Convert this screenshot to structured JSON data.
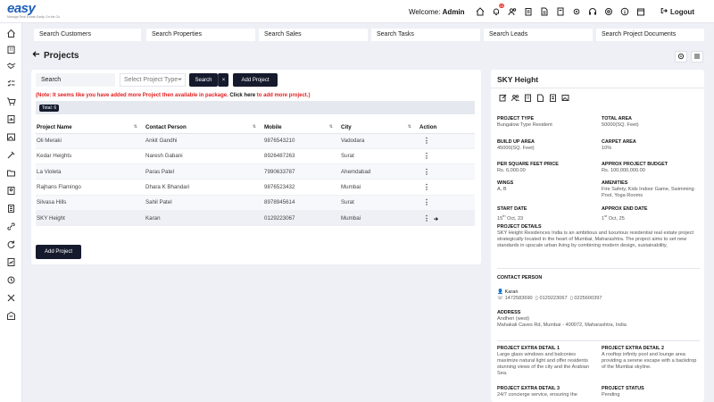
{
  "header": {
    "logo_text": "easy",
    "logo_tagline": "Manage Real Estate Easily On the Go",
    "welcome_label": "Welcome:",
    "welcome_user": "Admin",
    "notification_count": "23",
    "logout_label": "Logout"
  },
  "searches": [
    "Search Customers",
    "Search Properties",
    "Search Sales",
    "Search Tasks",
    "Search Leads",
    "Search Project Documents"
  ],
  "page": {
    "title": "Projects"
  },
  "filters": {
    "search_placeholder": "Search",
    "select_placeholder": "Select Project Type",
    "search_button": "Search",
    "clear_button": "×",
    "add_button": "Add Project"
  },
  "note": {
    "red": "(Note: It seems like you have added more Project then available in package.",
    "black": "Click here",
    "red_tail": "to add more project.)"
  },
  "total_label": "Total: 6",
  "table": {
    "headers": [
      "Project Name",
      "Contact Person",
      "Mobile",
      "City",
      "Action"
    ],
    "rows": [
      {
        "name": "Oli Meraki",
        "contact": "Ankit Gandhi",
        "mobile": "9876543210",
        "city": "Vadodara"
      },
      {
        "name": "Kedar Heights",
        "contact": "Naresh Gabani",
        "mobile": "8926487263",
        "city": "Surat"
      },
      {
        "name": "La Violeta",
        "contact": "Paras Patel",
        "mobile": "7990633787",
        "city": "Ahemdabad"
      },
      {
        "name": "Rajhans Flamingo",
        "contact": "Dhara K Bhandari",
        "mobile": "9876523432",
        "city": "Mumbai"
      },
      {
        "name": "Silvasa Hills",
        "contact": "Sahil Patel",
        "mobile": "8978945614",
        "city": "Surat"
      },
      {
        "name": "SKY Height",
        "contact": "Karan",
        "mobile": "0129223067",
        "city": "Mumbai"
      }
    ]
  },
  "add_project_bottom": "Add Project",
  "detail": {
    "title": "SKY Height",
    "project_type_label": "PROJECT TYPE",
    "project_type": "Bungalow Type Resident",
    "total_area_label": "TOTAL AREA",
    "total_area": "50000(SQ. Feet)",
    "build_up_label": "BUILD UP AREA",
    "build_up": "45000(SQ. Feet)",
    "carpet_label": "CARPET AREA",
    "carpet": "10%",
    "psf_label": "PER SQUARE FEET PRICE",
    "psf": "Rs. 6,000.00",
    "budget_label": "APPROX PROJECT BUDGET",
    "budget": "Rs. 100,000,000.00",
    "wings_label": "WINGS",
    "wings": "A, B",
    "amenities_label": "AMENITIES",
    "amenities": "Fire Safety, Kids Indoor Game, Swimming Pool, Yoga Rooms",
    "start_label": "START DATE",
    "start_day": "15",
    "start_suffix": "th",
    "start_rest": " Oct, 23",
    "end_label": "APPROX END DATE",
    "end_day": "1",
    "end_suffix": "st",
    "end_rest": " Oct, 25",
    "details_label": "PROJECT DETAILS",
    "details": "SKY Height Residences India is an ambitious and luxurious residential real estate project strategically located in the heart of Mumbai, Maharashtra. The project aims to set new standards in upscale urban living by combining modern design, sustainability,",
    "contact_label": "CONTACT PERSON",
    "contact_name": "Karan",
    "phone1": "1472583690",
    "phone2": "0129223067",
    "phone3": "0225600397",
    "address_label": "ADDRESS",
    "address1": "Andheri (west)",
    "address2": "Mahakali Caves Rd, Mumbai - 400072, Maharashtra, India",
    "extra1_label": "PROJECT EXTRA DETAIL 1",
    "extra1": "Large glass windows and balconies maximize natural light and offer residents stunning views of the city and the Arabian Sea.",
    "extra2_label": "PROJECT EXTRA DETAIL 2",
    "extra2": "A rooftop infinity pool and lounge area providing a serene escape with a backdrop of the Mumbai skyline.",
    "extra3_label": "PROJECT EXTRA DETAIL 3",
    "extra3": "24/7 concierge service, ensuring the",
    "status_label": "PROJECT STATUS",
    "status": "Pending"
  }
}
